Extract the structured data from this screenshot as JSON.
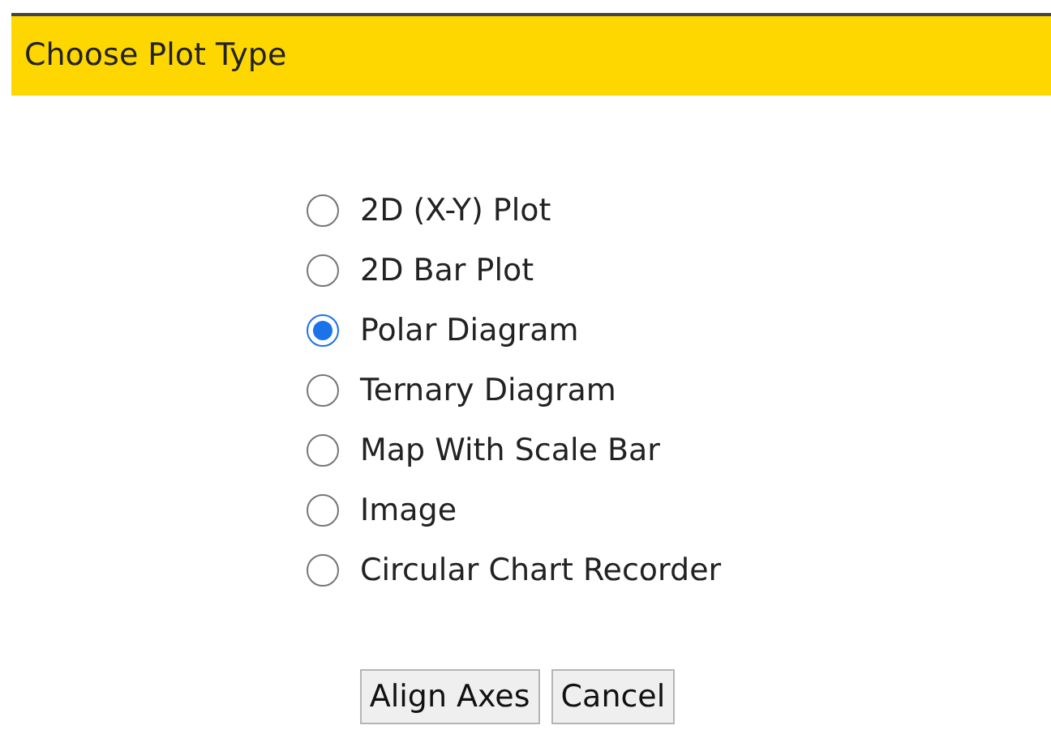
{
  "dialog": {
    "title": "Choose Plot Type"
  },
  "options": [
    {
      "label": "2D (X-Y) Plot",
      "selected": false
    },
    {
      "label": "2D Bar Plot",
      "selected": false
    },
    {
      "label": "Polar Diagram",
      "selected": true
    },
    {
      "label": "Ternary Diagram",
      "selected": false
    },
    {
      "label": "Map With Scale Bar",
      "selected": false
    },
    {
      "label": "Image",
      "selected": false
    },
    {
      "label": "Circular Chart Recorder",
      "selected": false
    }
  ],
  "buttons": [
    "Align Axes",
    "Cancel"
  ]
}
